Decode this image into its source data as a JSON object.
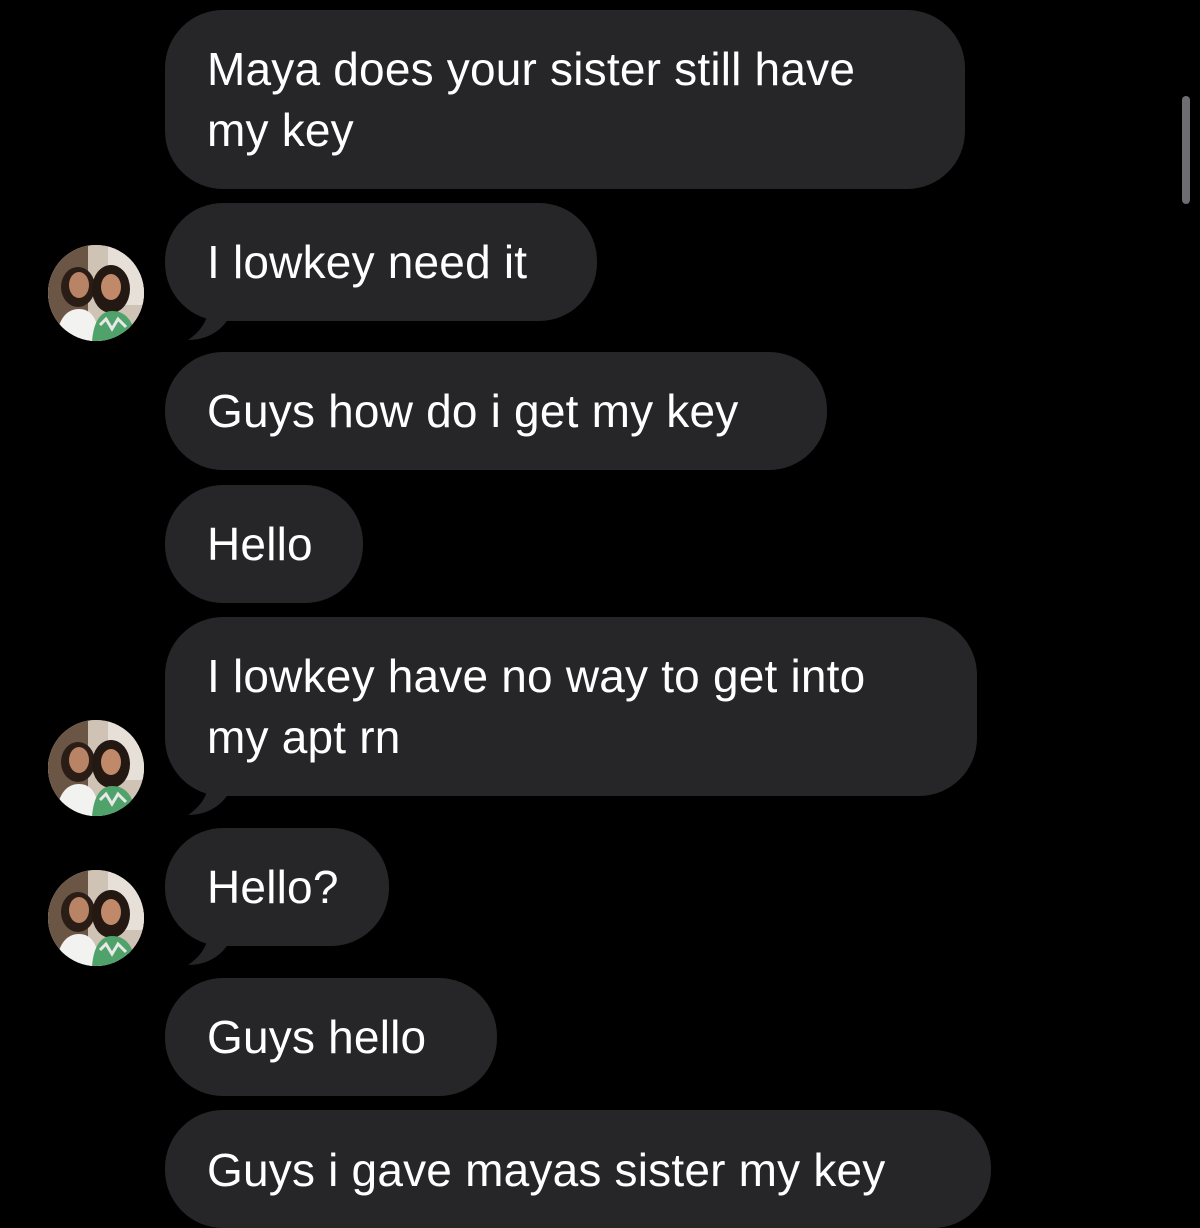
{
  "messages": [
    {
      "text": "Maya does your sister still have my key"
    },
    {
      "text": "I lowkey need it"
    },
    {
      "text": "Guys how do i get my key"
    },
    {
      "text": "Hello"
    },
    {
      "text": "I lowkey have no way to get into my apt rn"
    },
    {
      "text": "Hello?"
    },
    {
      "text": "Guys hello"
    },
    {
      "text": "Guys i gave mayas sister my key"
    }
  ],
  "colors": {
    "background": "#000000",
    "bubble": "#262628",
    "text": "#ffffff",
    "scrollbar": "#6d6d72"
  },
  "icons": {
    "avatar": "sender-avatar-photo"
  }
}
